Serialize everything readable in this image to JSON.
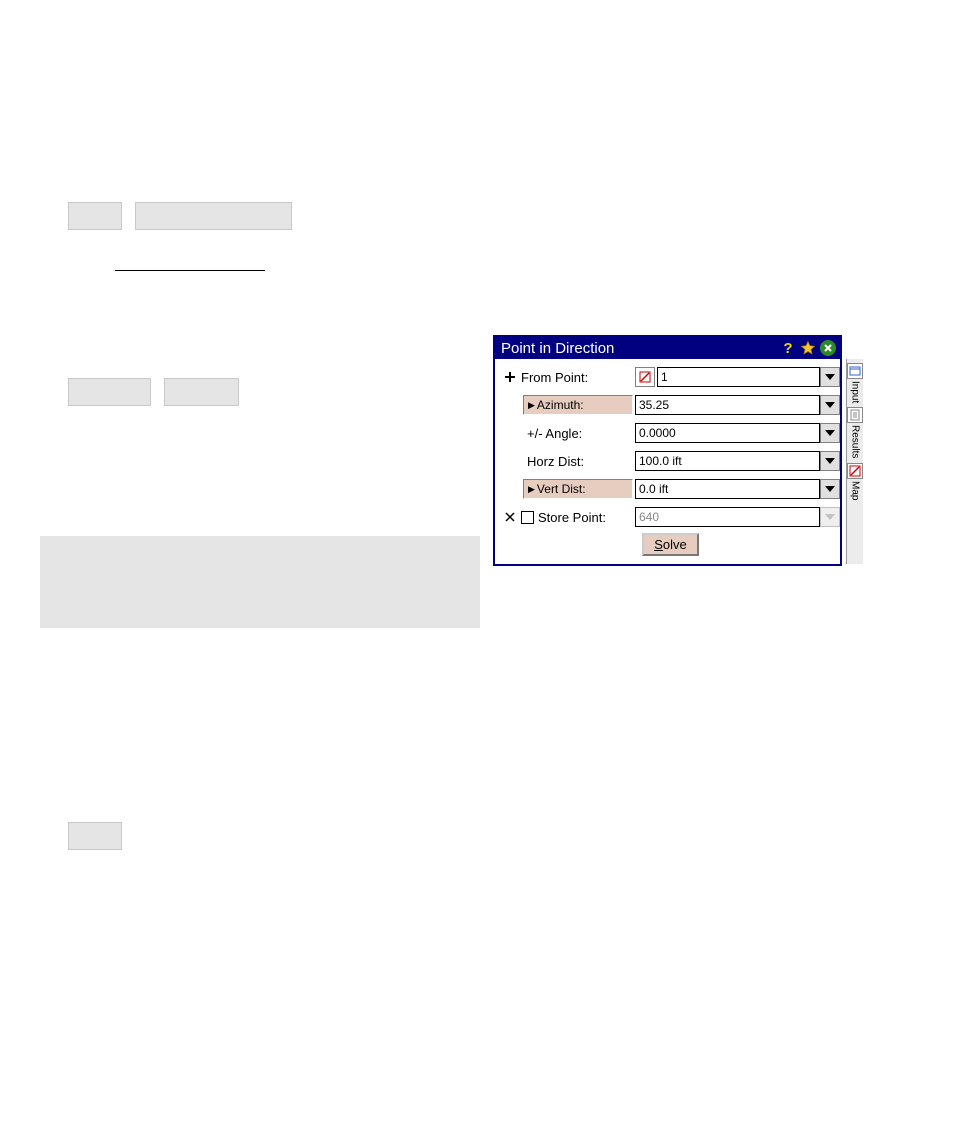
{
  "dialog": {
    "title": "Point in Direction",
    "rows": {
      "from_point": {
        "label": "From Point:",
        "value": "1"
      },
      "azimuth": {
        "label": "Azimuth:",
        "value": "35.25"
      },
      "angle": {
        "label": "+/- Angle:",
        "value": "0.0000"
      },
      "horz_dist": {
        "label": "Horz Dist:",
        "value": "100.0 ift"
      },
      "vert_dist": {
        "label": "Vert Dist:",
        "value": "0.0 ift"
      },
      "store_point": {
        "label": "Store Point:",
        "value": "640"
      }
    },
    "solve_label": "Solve",
    "tabs": {
      "input": "Input",
      "results": "Results",
      "map": "Map"
    }
  }
}
